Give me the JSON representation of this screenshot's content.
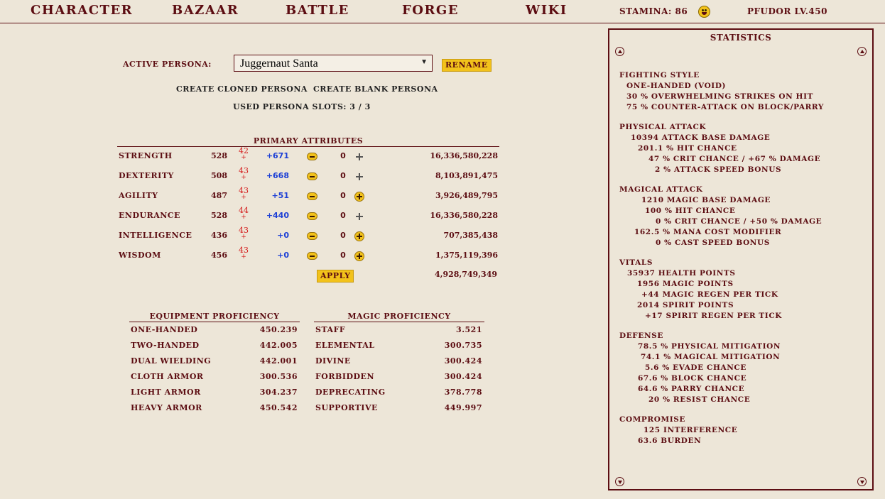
{
  "nav": {
    "character": "CHARACTER",
    "bazaar": "BAZAAR",
    "battle": "BATTLE",
    "forge": "FORGE",
    "wiki": "WIKI",
    "stamina": "STAMINA: 86",
    "player": "PFUDOR LV.450"
  },
  "persona": {
    "label": "ACTIVE PERSONA:",
    "selected": "Juggernaut Santa",
    "rename": "RENAME",
    "create_cloned": "CREATE CLONED PERSONA",
    "create_blank": "CREATE BLANK PERSONA",
    "slots": "USED PERSONA SLOTS:  3 / 3"
  },
  "attributes": {
    "header": "PRIMARY ATTRIBUTES",
    "rows": [
      {
        "name": "STRENGTH",
        "base": "528",
        "mod": "42",
        "bonus": "+671",
        "spend": "0",
        "plus": "gray",
        "exp": "16,336,580,228"
      },
      {
        "name": "DEXTERITY",
        "base": "508",
        "mod": "43",
        "bonus": "+668",
        "spend": "0",
        "plus": "gray",
        "exp": "8,103,891,475"
      },
      {
        "name": "AGILITY",
        "base": "487",
        "mod": "43",
        "bonus": "+51",
        "spend": "0",
        "plus": "gold",
        "exp": "3,926,489,795"
      },
      {
        "name": "ENDURANCE",
        "base": "528",
        "mod": "44",
        "bonus": "+440",
        "spend": "0",
        "plus": "gray",
        "exp": "16,336,580,228"
      },
      {
        "name": "INTELLIGENCE",
        "base": "436",
        "mod": "43",
        "bonus": "+0",
        "spend": "0",
        "plus": "gold",
        "exp": "707,385,438"
      },
      {
        "name": "WISDOM",
        "base": "456",
        "mod": "43",
        "bonus": "+0",
        "spend": "0",
        "plus": "gold",
        "exp": "1,375,119,396"
      }
    ],
    "mod_sign": "+",
    "apply": "APPLY",
    "total_exp": "4,928,749,349"
  },
  "equipment": {
    "header": "EQUIPMENT PROFICIENCY",
    "rows": [
      {
        "name": "ONE-HANDED",
        "value": "450.239"
      },
      {
        "name": "TWO-HANDED",
        "value": "442.005"
      },
      {
        "name": "DUAL WIELDING",
        "value": "442.001"
      },
      {
        "name": "CLOTH ARMOR",
        "value": "300.536"
      },
      {
        "name": "LIGHT ARMOR",
        "value": "304.237"
      },
      {
        "name": "HEAVY ARMOR",
        "value": "450.542"
      }
    ]
  },
  "magic": {
    "header": "MAGIC PROFICIENCY",
    "rows": [
      {
        "name": "STAFF",
        "value": "3.521"
      },
      {
        "name": "ELEMENTAL",
        "value": "300.735"
      },
      {
        "name": "DIVINE",
        "value": "300.424"
      },
      {
        "name": "FORBIDDEN",
        "value": "300.424"
      },
      {
        "name": "DEPRECATING",
        "value": "378.778"
      },
      {
        "name": "SUPPORTIVE",
        "value": "449.997"
      }
    ]
  },
  "stats": {
    "title": "STATISTICS",
    "lines": [
      "FIGHTING STYLE",
      "ONE-HANDED (VOID)",
      "30 % OVERWHELMING STRIKES ON HIT",
      "75 % COUNTER-ATTACK ON BLOCK/PARRY",
      "PHYSICAL ATTACK",
      "10394 ATTACK BASE DAMAGE",
      "201.1 % HIT CHANCE",
      "47 % CRIT CHANCE / +67 % DAMAGE",
      "2 % ATTACK SPEED BONUS",
      "MAGICAL ATTACK",
      "1210 MAGIC BASE DAMAGE",
      "100 % HIT CHANCE",
      "0 % CRIT CHANCE / +50 % DAMAGE",
      "162.5 % MANA COST MODIFIER",
      "0 % CAST SPEED BONUS",
      "VITALS",
      "35937 HEALTH POINTS",
      "1956 MAGIC POINTS",
      "+44 MAGIC REGEN PER TICK",
      "2014 SPIRIT POINTS",
      "+17 SPIRIT REGEN PER TICK",
      "DEFENSE",
      "78.5 % PHYSICAL MITIGATION",
      "74.1 % MAGICAL MITIGATION",
      "5.6 % EVADE CHANCE",
      "67.6 % BLOCK CHANCE",
      "64.6 % PARRY CHANCE",
      "20 % RESIST CHANCE",
      "COMPROMISE",
      "125 INTERFERENCE",
      "63.6 BURDEN"
    ]
  }
}
